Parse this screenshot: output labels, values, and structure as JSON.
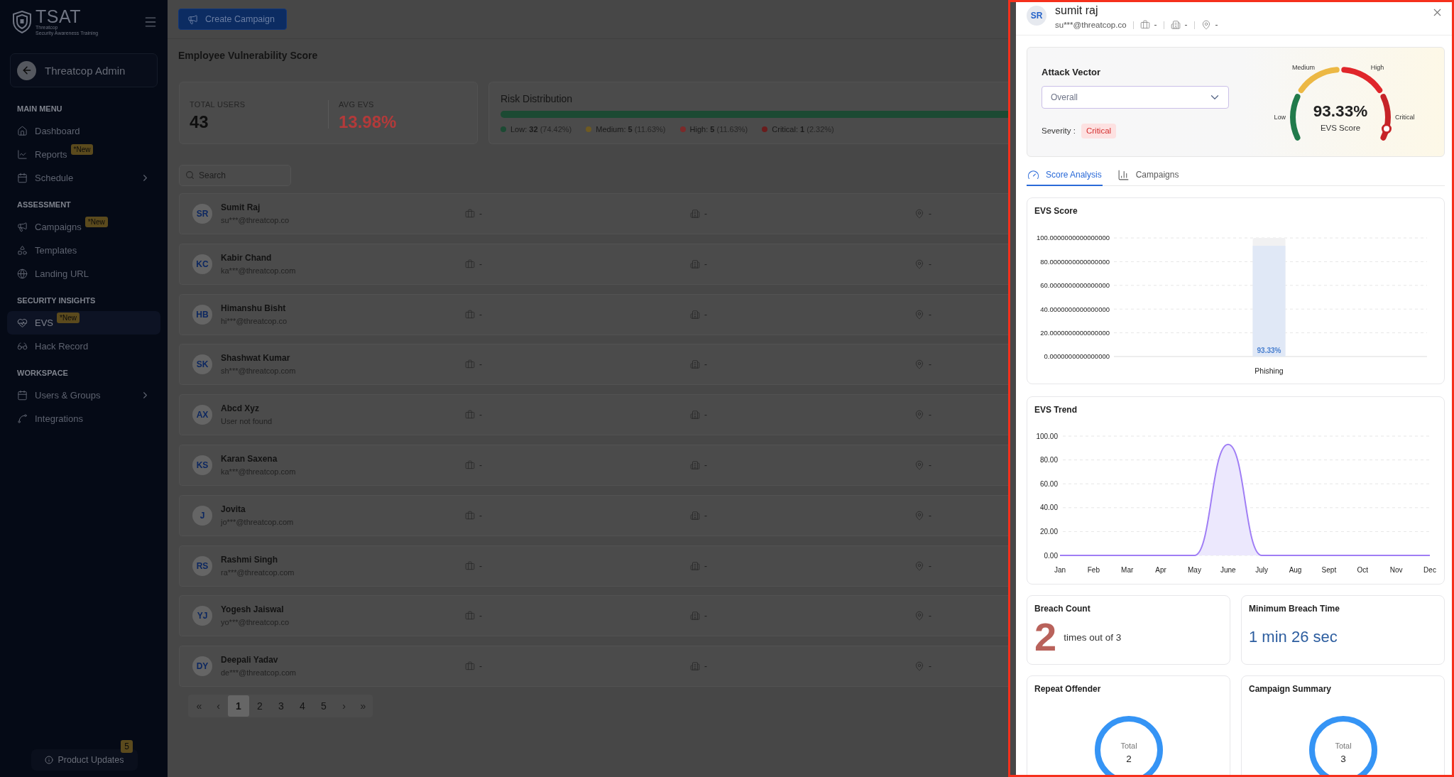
{
  "sidebar": {
    "logo": {
      "title": "TSAT",
      "tagline": [
        "Threatcop",
        "Security Awareness Training"
      ]
    },
    "account": {
      "name": "Threatcop Admin"
    },
    "sections": [
      {
        "heading": "MAIN MENU",
        "items": [
          {
            "label": "Dashboard",
            "selected": false,
            "expandable": false
          },
          {
            "label": "Reports",
            "badge": "*New",
            "selected": false,
            "expandable": false
          },
          {
            "label": "Schedule",
            "selected": false,
            "expandable": true
          }
        ]
      },
      {
        "heading": "ASSESSMENT",
        "items": [
          {
            "label": "Campaigns",
            "badge": "*New",
            "selected": false,
            "expandable": false
          },
          {
            "label": "Templates",
            "selected": false,
            "expandable": false
          },
          {
            "label": "Landing URL",
            "selected": false,
            "expandable": false
          }
        ]
      },
      {
        "heading": "SECURITY INSIGHTS",
        "items": [
          {
            "label": "EVS",
            "badge": "*New",
            "selected": true,
            "expandable": false
          },
          {
            "label": "Hack Record",
            "selected": false,
            "expandable": false
          }
        ]
      },
      {
        "heading": "WORKSPACE",
        "items": [
          {
            "label": "Users & Groups",
            "selected": false,
            "expandable": true
          },
          {
            "label": "Integrations",
            "selected": false,
            "expandable": false
          }
        ]
      }
    ],
    "product_updates": {
      "label": "Product Updates",
      "count": "5"
    }
  },
  "toolbar": {
    "create_button": "Create Campaign"
  },
  "page_title": "Employee Vulnerability Score",
  "stats": [
    {
      "label": "TOTAL USERS",
      "value": "43",
      "kind": "count"
    },
    {
      "label": "AVG EVS",
      "value": "13.98%",
      "kind": "score"
    }
  ],
  "risk_distribution": {
    "title": "Risk Distribution",
    "segments": [
      {
        "label": "Low:",
        "count": "32",
        "share": "(74.42%)",
        "color": "#1c4a33"
      },
      {
        "label": "Medium:",
        "count": "5",
        "share": "(11.63%)",
        "color": "#6e5a22"
      },
      {
        "label": "High:",
        "count": "5",
        "share": "(11.63%)",
        "color": "#7c2a2a"
      },
      {
        "label": "Critical:",
        "count": "1",
        "share": "(2.32%)",
        "color": "#6a1d1d"
      }
    ]
  },
  "search": {
    "placeholder": "Search"
  },
  "users": [
    {
      "initials": "SR",
      "name": "Sumit Raj",
      "email": "su***@threatcop.co",
      "department": "-",
      "company": "-",
      "location": "-"
    },
    {
      "initials": "KC",
      "name": "Kabir Chand",
      "email": "ka***@threatcop.com",
      "department": "-",
      "company": "-",
      "location": "-"
    },
    {
      "initials": "HB",
      "name": "Himanshu Bisht",
      "email": "hi***@threatcop.co",
      "department": "-",
      "company": "-",
      "location": "-"
    },
    {
      "initials": "SK",
      "name": "Shashwat Kumar",
      "email": "sh***@threatcop.com",
      "department": "-",
      "company": "-",
      "location": "-"
    },
    {
      "initials": "AX",
      "name": "Abcd Xyz",
      "email": "User not found",
      "department": "-",
      "company": "-",
      "location": "-"
    },
    {
      "initials": "KS",
      "name": "Karan Saxena",
      "email": "ka***@threatcop.com",
      "department": "-",
      "company": "-",
      "location": "-"
    },
    {
      "initials": "J",
      "name": "Jovita",
      "email": "jo***@threatcop.com",
      "department": "-",
      "company": "-",
      "location": "-"
    },
    {
      "initials": "RS",
      "name": "Rashmi Singh",
      "email": "ra***@threatcop.com",
      "department": "-",
      "company": "-",
      "location": "-"
    },
    {
      "initials": "YJ",
      "name": "Yogesh Jaiswal",
      "email": "yo***@threatcop.co",
      "department": "-",
      "company": "-",
      "location": "-"
    },
    {
      "initials": "DY",
      "name": "Deepali Yadav",
      "email": "de***@threatcop.com",
      "department": "-",
      "company": "-",
      "location": "-"
    }
  ],
  "pagination": {
    "first": "«",
    "prev": "‹",
    "pages": [
      {
        "label": "1",
        "selected": true
      },
      {
        "label": "2",
        "selected": false
      },
      {
        "label": "3",
        "selected": false
      },
      {
        "label": "4",
        "selected": false
      },
      {
        "label": "5",
        "selected": false
      }
    ],
    "next": "›",
    "last": "»"
  },
  "user_drawer": {
    "initials": "SR",
    "name": "sumit raj",
    "email": "su***@threatcop.co",
    "department": "-",
    "company": "-",
    "location": "-",
    "attack_vector": {
      "label": "Attack Vector",
      "value": "Overall",
      "severity_label": "Severity :",
      "severity": "Critical"
    },
    "gauge": {
      "value": "93.33%",
      "caption": "EVS Score",
      "level": 0.9333,
      "bands": [
        {
          "label": "Low",
          "color": "#217a4b"
        },
        {
          "label": "Medium",
          "color": "#ecb844"
        },
        {
          "label": "High",
          "color": "#e0262b"
        },
        {
          "label": "Critical",
          "color": "#c62428"
        }
      ]
    },
    "tabs": [
      {
        "label": "Score Analysis",
        "selected": true
      },
      {
        "label": "Campaigns",
        "selected": false
      }
    ],
    "evs_score": {
      "title": "EVS Score",
      "chart_data": {
        "type": "bar",
        "categories": [
          "Phishing"
        ],
        "values": [
          93.33
        ],
        "ylim": [
          0,
          100
        ],
        "yticks": [
          {
            "value": 0,
            "label": "0.0000000000000000"
          },
          {
            "value": 20,
            "label": "20.0000000000000000"
          },
          {
            "value": 40,
            "label": "40.0000000000000000"
          },
          {
            "value": 60,
            "label": "60.0000000000000000"
          },
          {
            "value": 80,
            "label": "80.0000000000000000"
          },
          {
            "value": 100,
            "label": "100.0000000000000000"
          }
        ],
        "grid": true,
        "value_labels": [
          "93.33%"
        ]
      }
    },
    "evs_trend": {
      "title": "EVS Trend",
      "chart_data": {
        "type": "area",
        "categories": [
          "Jan",
          "Feb",
          "Mar",
          "Apr",
          "May",
          "June",
          "July",
          "Aug",
          "Sept",
          "Oct",
          "Nov",
          "Dec"
        ],
        "series": [
          {
            "color": "#a07ef5",
            "values": [
              0,
              0,
              0,
              0,
              0,
              93,
              0,
              0,
              0,
              0,
              0,
              0
            ]
          }
        ],
        "ylim": [
          0,
          100
        ],
        "yticks": [
          {
            "value": 0,
            "label": "0.00"
          },
          {
            "value": 20,
            "label": "20.00"
          },
          {
            "value": 40,
            "label": "40.00"
          },
          {
            "value": 60,
            "label": "60.00"
          },
          {
            "value": 80,
            "label": "80.00"
          },
          {
            "value": 100,
            "label": "100.00"
          }
        ],
        "grid": true
      }
    },
    "breach_count": {
      "title": "Breach Count",
      "value": "2",
      "text": "times out of 3"
    },
    "min_breach_time": {
      "title": "Minimum Breach Time",
      "value": "1 min 26 sec"
    },
    "repeat_offender": {
      "title": "Repeat Offender",
      "total_label": "Total",
      "total": "2"
    },
    "campaign_summary": {
      "title": "Campaign Summary",
      "total_label": "Total",
      "total": "3"
    }
  }
}
